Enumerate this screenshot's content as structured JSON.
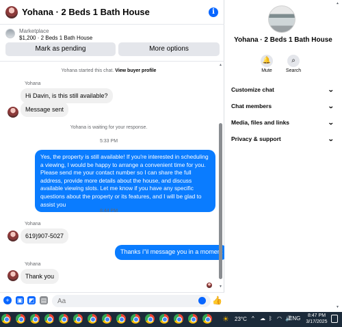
{
  "header": {
    "title": "Yohana · 2 Beds 1 Bath House",
    "info_icon": "i"
  },
  "marketplace": {
    "label": "Marketplace",
    "listing": "$1,200 · 2 Beds 1 Bath House",
    "buttons": {
      "mark_pending": "Mark as pending",
      "more_options": "More options"
    }
  },
  "thread": {
    "started_notice": "Yohana started this chat.",
    "view_profile": "View buyer profile",
    "sender_name": "Yohana",
    "messages_in_1": [
      "Hi Davin, is this still available?",
      "Message sent"
    ],
    "waiting_notice": "Yohana is waiting for your response.",
    "time_1": "5:33 PM",
    "message_out_1": "Yes, the property is still available! If you're interested in scheduling a viewing, I would be happy to arrange a convenient time for you. Please send me your contact number so I can share the full address, provide more details about the house, and discuss available viewing slots. Let me know if you have any specific questions about the property or its features, and I will be glad to assist you",
    "time_2": "8:44 PM",
    "message_in_2": "619)907-5027",
    "message_out_2": "Thanks i\"il message you in a moment",
    "message_in_3": "Thank you"
  },
  "composer": {
    "placeholder": "Aa"
  },
  "right_panel": {
    "title": "Yohana · 2 Beds 1 Bath House",
    "actions": [
      {
        "label": "Mute",
        "icon": "bell-icon"
      },
      {
        "label": "Search",
        "icon": "search-icon"
      }
    ],
    "sections": [
      "Customize chat",
      "Chat members",
      "Media, files and links",
      "Privacy & support"
    ]
  },
  "taskbar": {
    "temperature": "23°C",
    "language": "ENG",
    "time": "8:47 PM",
    "date": "3/17/2025"
  },
  "colors": {
    "accent": "#0866ff",
    "bubble_out": "#0a7cff",
    "bubble_in": "#f0f0f0",
    "taskbar": "#1c2b3a"
  }
}
